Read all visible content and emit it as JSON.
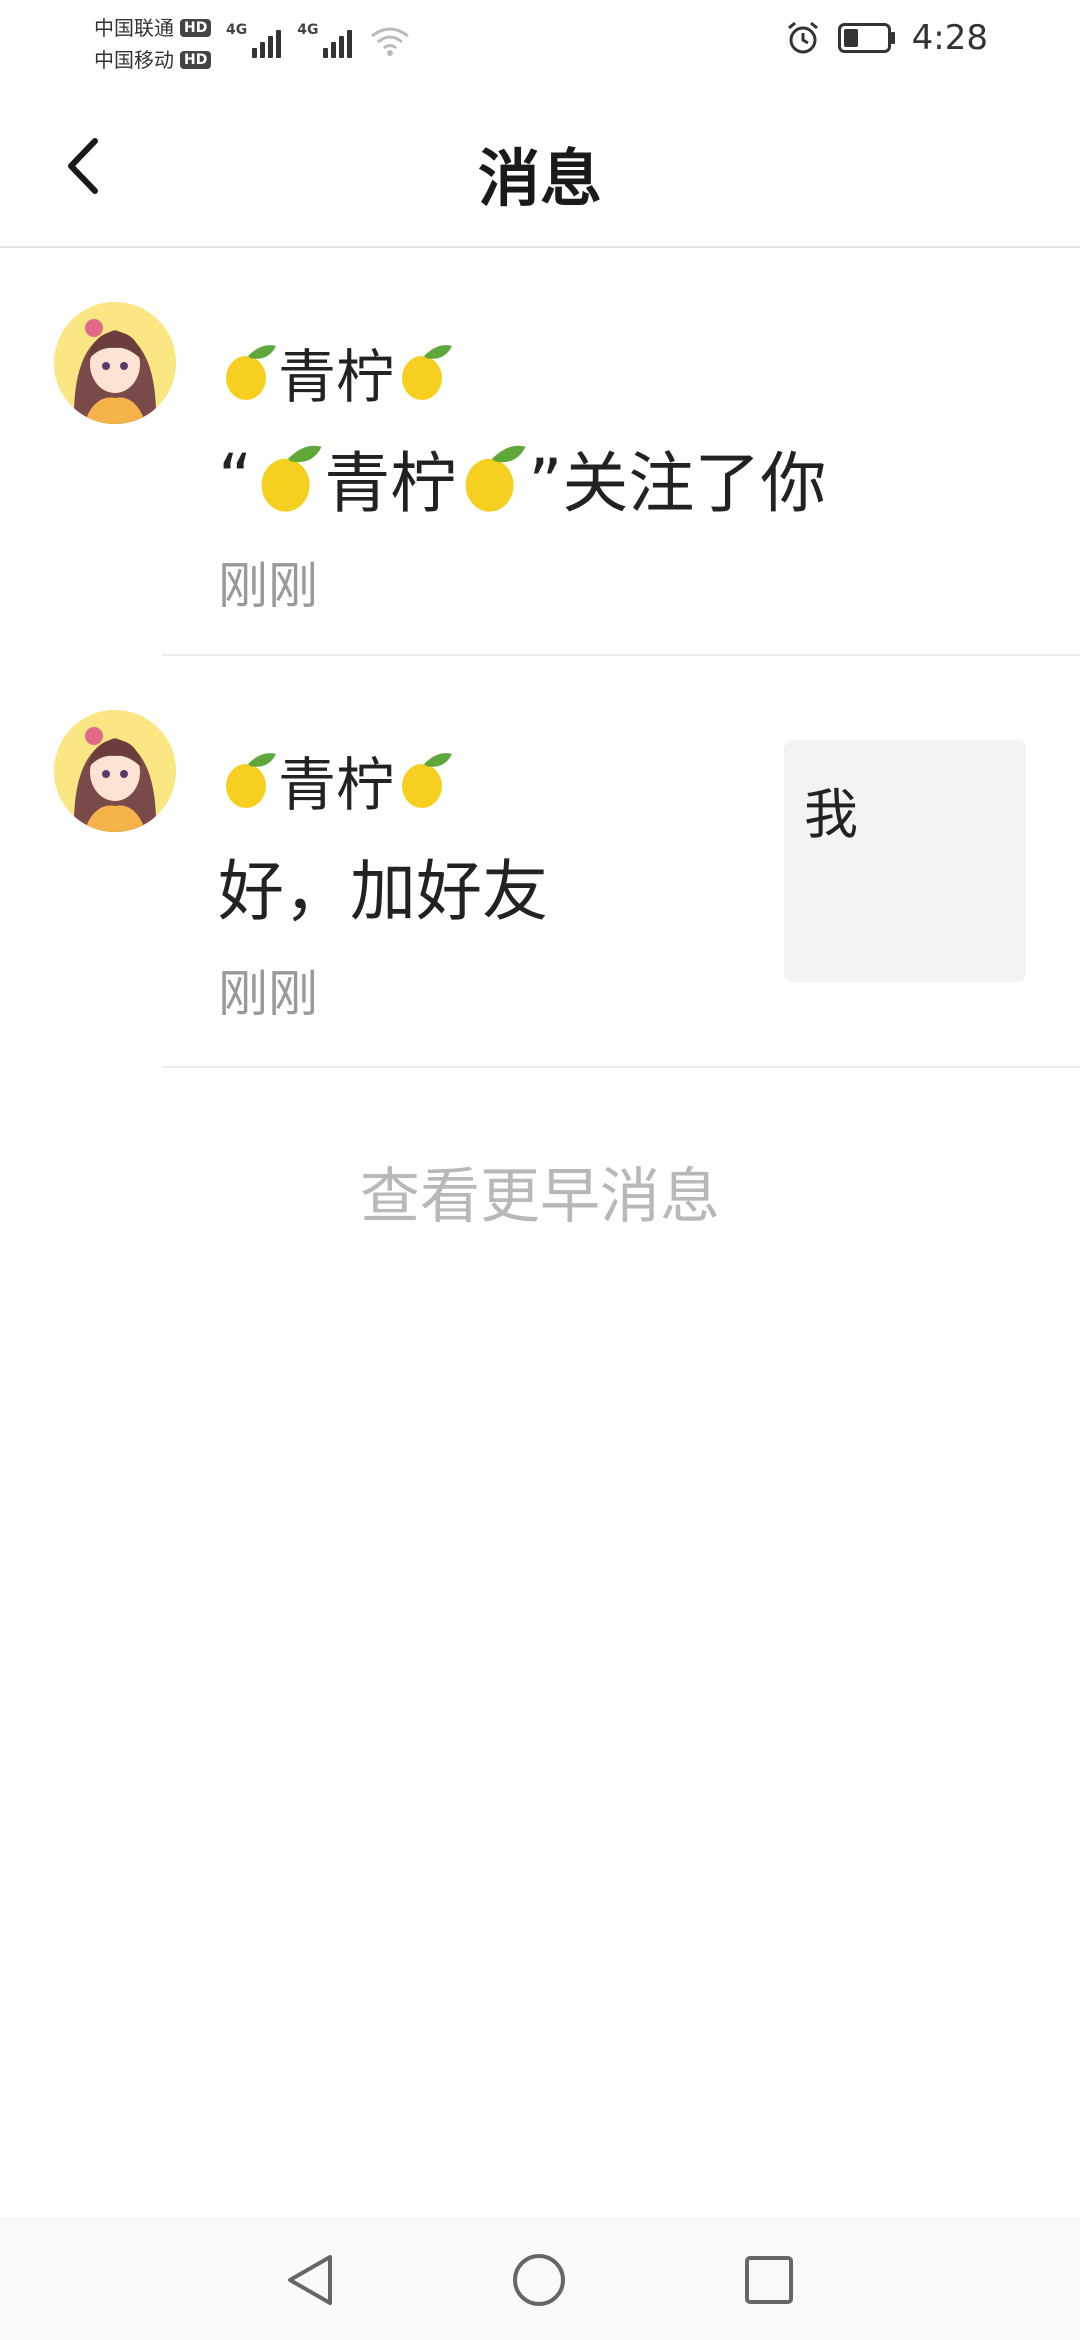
{
  "status_bar": {
    "carrier_1": "中国联通",
    "carrier_2": "中国移动",
    "hd_label": "HD",
    "network_1": "4G",
    "network_2": "4G",
    "time": "4:28"
  },
  "header": {
    "title": "消息"
  },
  "messages": [
    {
      "sender_name": "青柠",
      "body_prefix": "“",
      "body_name": "青柠",
      "body_suffix": "”关注了你",
      "time": "刚刚"
    },
    {
      "sender_name": "青柠",
      "body": "好，加好友",
      "time": "刚刚",
      "ref_text": "我"
    }
  ],
  "earlier_link": "查看更早消息",
  "colors": {
    "lemon": "#f5d020",
    "leaf": "#5ea83a",
    "avatar_bg": "#fbe684",
    "muted_text": "#999999",
    "link_text": "#b8b8b8"
  }
}
